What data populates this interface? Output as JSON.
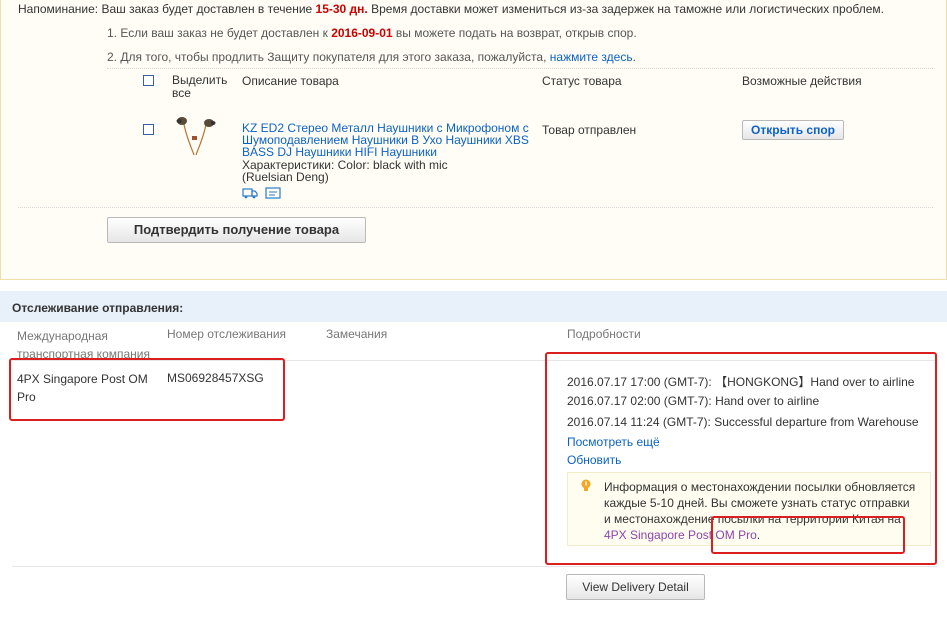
{
  "reminder": {
    "label": "Напоминание:",
    "line1_pre": "Ваш заказ будет доставлен в течение ",
    "line1_days": "15-30 дн.",
    "line1_post": " Время доставки может измениться из-за задержек на таможне или логистических проблем.",
    "item1_pre": "1. Если ваш заказ не будет доставлен к ",
    "item1_date": "2016-09-01",
    "item1_post": " вы можете подать на возврат, открыв спор.",
    "item2_pre": "2. Для того, чтобы продлить Защиту покупателя для этого заказа, пожалуйста, ",
    "item2_link": "нажмите здесь",
    "item2_post": "."
  },
  "order_table": {
    "headers": {
      "select_all": "Выделить все",
      "description": "Описание товара",
      "status": "Статус товара",
      "actions": "Возможные действия"
    },
    "item": {
      "title": "KZ ED2 Стерео Металл Наушники с Микрофоном с Шумоподавлением Наушники В Ухо Наушники XBS BASS DJ Наушники HIFI Наушники",
      "specs": "Характеристики: Color: black with mic",
      "seller": "(Ruelsian Deng)",
      "status": "Товар отправлен",
      "action_button": "Открыть спор"
    },
    "confirm_button": "Подтвердить получение товара"
  },
  "tracking": {
    "section_title": "Отслеживание отправления:",
    "headers": {
      "carrier": "Международная транспортная компания",
      "tracking_number": "Номер отслеживания",
      "remarks": "Замечания",
      "details": "Подробности"
    },
    "carrier": "4PX Singapore Post OM Pro",
    "tracking_number": "MS06928457XSG",
    "events": [
      "2016.07.17 17:00 (GMT-7): 【HONGKONG】Hand over to airline",
      "2016.07.17 02:00 (GMT-7): Hand over to airline",
      "2016.07.14 11:24 (GMT-7): Successful departure from Warehouse"
    ],
    "see_more": "Посмотреть ещё",
    "refresh": "Обновить",
    "info_text": "Информация о местонахождении посылки обновляется каждые 5-10 дней. Вы сможете узнать статус отправки и местонахождение посылки на территории Китая на ",
    "info_link": "4PX Singapore Post OM Pro",
    "info_end": ".",
    "view_button": "View Delivery Detail"
  },
  "colors": {
    "link": "#0b62c4",
    "highlight_red": "#cc0000",
    "annotation_box": "#d9201e",
    "tracking_header_bg": "#e8f0fa",
    "reminder_bg": "#fffdf5"
  },
  "icons": [
    "lightbulb-icon",
    "shipping-icon",
    "message-icon"
  ]
}
